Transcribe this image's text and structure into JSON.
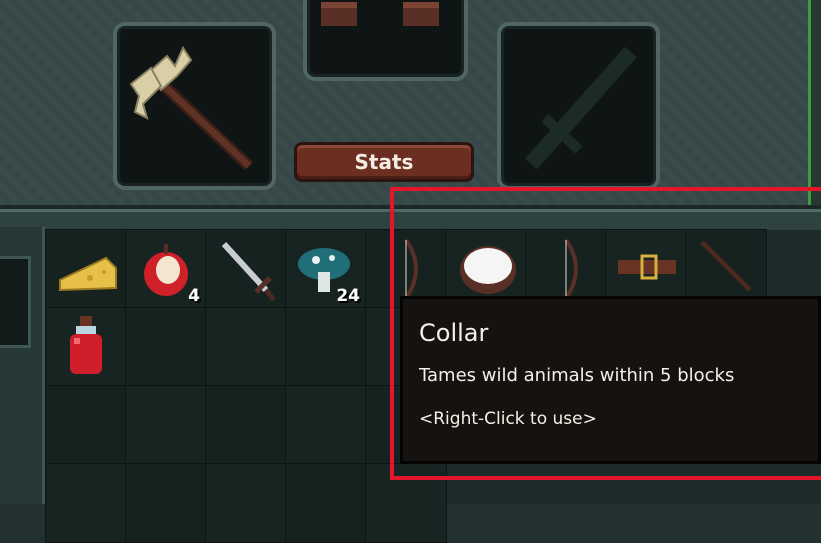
{
  "equipment": {
    "stats_label": "Stats",
    "weapon_icon": "axe-icon",
    "armor_icon": "boots-icon",
    "offhand_icon": "sword-silhouette-icon"
  },
  "inventory": {
    "slots": [
      {
        "icon": "cheese-icon",
        "count": ""
      },
      {
        "icon": "apple-icon",
        "count": "4"
      },
      {
        "icon": "sword-icon",
        "count": ""
      },
      {
        "icon": "mushroom-icon",
        "count": "24"
      },
      {
        "icon": "bow-icon",
        "count": ""
      },
      {
        "icon": "coconut-icon",
        "count": ""
      },
      {
        "icon": "bow-icon",
        "count": ""
      },
      {
        "icon": "collar-icon",
        "count": ""
      },
      {
        "icon": "staff-icon",
        "count": ""
      },
      {
        "icon": "potion-icon",
        "count": ""
      }
    ]
  },
  "tooltip": {
    "title": "Collar",
    "description": "Tames wild animals within 5 blocks",
    "hint": "<Right-Click to use>"
  },
  "colors": {
    "highlight": "#e3162b",
    "button": "#6b2f22"
  }
}
